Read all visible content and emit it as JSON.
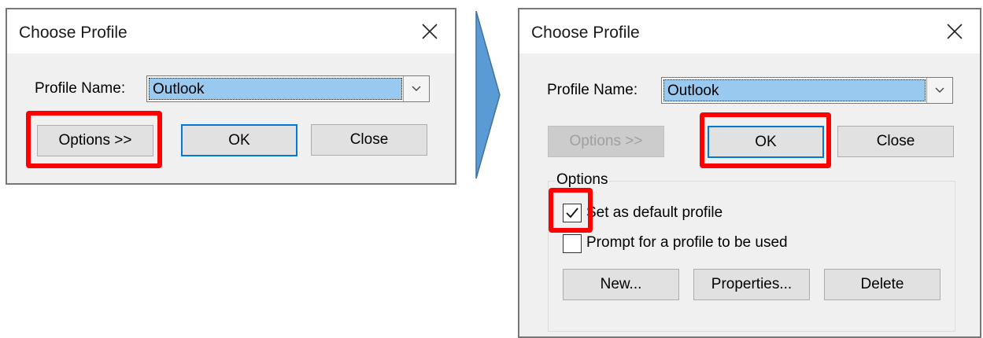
{
  "dialog_before": {
    "title": "Choose Profile",
    "profile_label": "Profile Name:",
    "profile_value": "Outlook",
    "options_button": "Options >>",
    "ok_button": "OK",
    "close_button": "Close"
  },
  "dialog_after": {
    "title": "Choose Profile",
    "profile_label": "Profile Name:",
    "profile_value": "Outlook",
    "options_button": "Options >>",
    "ok_button": "OK",
    "close_button": "Close",
    "options_group_title": "Options",
    "set_default_label": "Set as default profile",
    "set_default_checked": true,
    "prompt_label": "Prompt for a profile to be used",
    "prompt_checked": false,
    "new_button": "New...",
    "properties_button": "Properties...",
    "delete_button": "Delete"
  },
  "colors": {
    "highlight": "#ff0000",
    "arrow": "#5b9bd5",
    "selection": "#99c9ef",
    "default_button_border": "#0078d7"
  }
}
